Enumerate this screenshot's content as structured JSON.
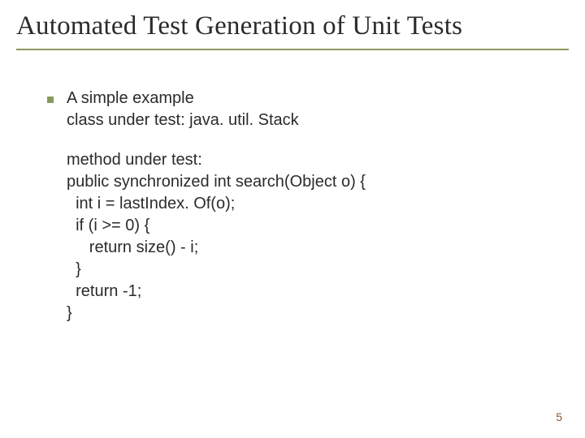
{
  "title": "Automated Test Generation of Unit Tests",
  "intro": {
    "heading": "A simple example",
    "class_line": "class under test: java. util. Stack"
  },
  "code": {
    "l1": "method under test:",
    "l2": "public synchronized int search(Object o) {",
    "l3": "  int i = lastIndex. Of(o);",
    "l4": "  if (i >= 0) {",
    "l5": "     return size() - i;",
    "l6": "  }",
    "l7": "  return -1;",
    "l8": "}"
  },
  "page_number": "5"
}
